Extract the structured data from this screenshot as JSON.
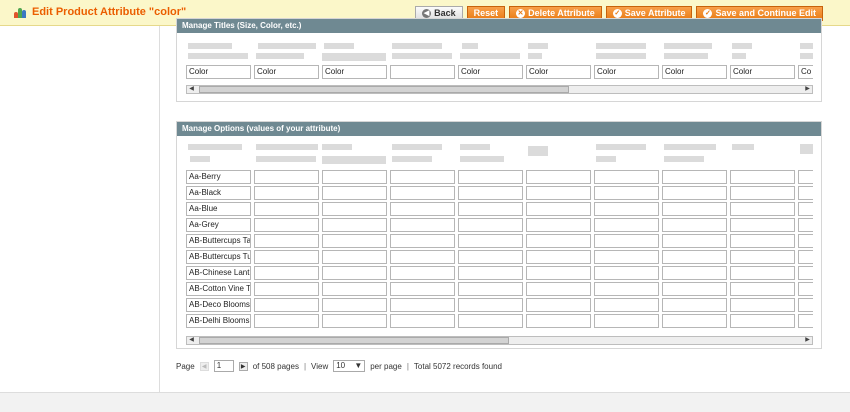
{
  "header": {
    "title": "Edit Product Attribute \"color\"",
    "buttons": {
      "back": "Back",
      "reset": "Reset",
      "delete": "Delete Attribute",
      "save": "Save Attribute",
      "save_continue": "Save and Continue Edit"
    }
  },
  "titles_section": {
    "heading": "Manage Titles (Size, Color, etc.)",
    "values": [
      "Color",
      "Color",
      "Color",
      "",
      "Color",
      "Color",
      "Color",
      "Color",
      "Color",
      "Co"
    ]
  },
  "options_section": {
    "heading": "Manage Options (values of your attribute)",
    "options": [
      "Aa-Berry",
      "Aa-Black",
      "Aa-Blue",
      "Aa-Grey",
      "AB-Buttercups Ta",
      "AB-Buttercups Tu",
      "AB-Chinese Lant",
      "AB-Cotton Vine T",
      "AB-Deco Blooms",
      "AB-Delhi Blooms"
    ]
  },
  "pager": {
    "page_label": "Page",
    "current_page": "1",
    "of_pages": "of 508 pages",
    "view_label": "View",
    "per_page": "10",
    "per_page_label": "per page",
    "total": "Total 5072 records found"
  }
}
